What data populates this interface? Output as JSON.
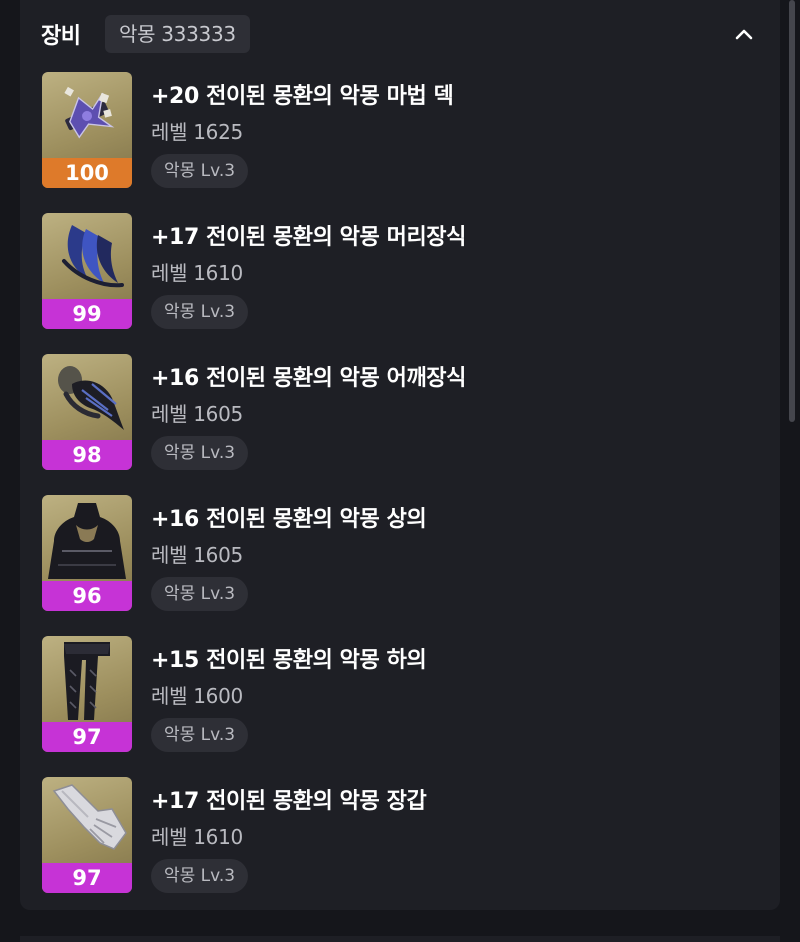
{
  "header": {
    "title": "장비",
    "set_badge": "악몽 333333"
  },
  "items": [
    {
      "name": "+20 전이된 몽환의 악몽 마법 덱",
      "level": "레벨 1625",
      "tag": "악몽 Lv.3",
      "quality": "100",
      "quality_color": "#de7a2a"
    },
    {
      "name": "+17 전이된 몽환의 악몽 머리장식",
      "level": "레벨 1610",
      "tag": "악몽 Lv.3",
      "quality": "99",
      "quality_color": "#c633d6"
    },
    {
      "name": "+16 전이된 몽환의 악몽 어깨장식",
      "level": "레벨 1605",
      "tag": "악몽 Lv.3",
      "quality": "98",
      "quality_color": "#c633d6"
    },
    {
      "name": "+16 전이된 몽환의 악몽 상의",
      "level": "레벨 1605",
      "tag": "악몽 Lv.3",
      "quality": "96",
      "quality_color": "#c633d6"
    },
    {
      "name": "+15 전이된 몽환의 악몽 하의",
      "level": "레벨 1600",
      "tag": "악몽 Lv.3",
      "quality": "97",
      "quality_color": "#c633d6"
    },
    {
      "name": "+17 전이된 몽환의 악몽 장갑",
      "level": "레벨 1610",
      "tag": "악몽 Lv.3",
      "quality": "97",
      "quality_color": "#c633d6"
    }
  ],
  "icons": {
    "collapse": "chevron-up-icon",
    "item_icons": [
      "card-deck-icon",
      "headpiece-icon",
      "shoulder-icon",
      "chest-armor-icon",
      "leg-armor-icon",
      "glove-icon"
    ]
  }
}
